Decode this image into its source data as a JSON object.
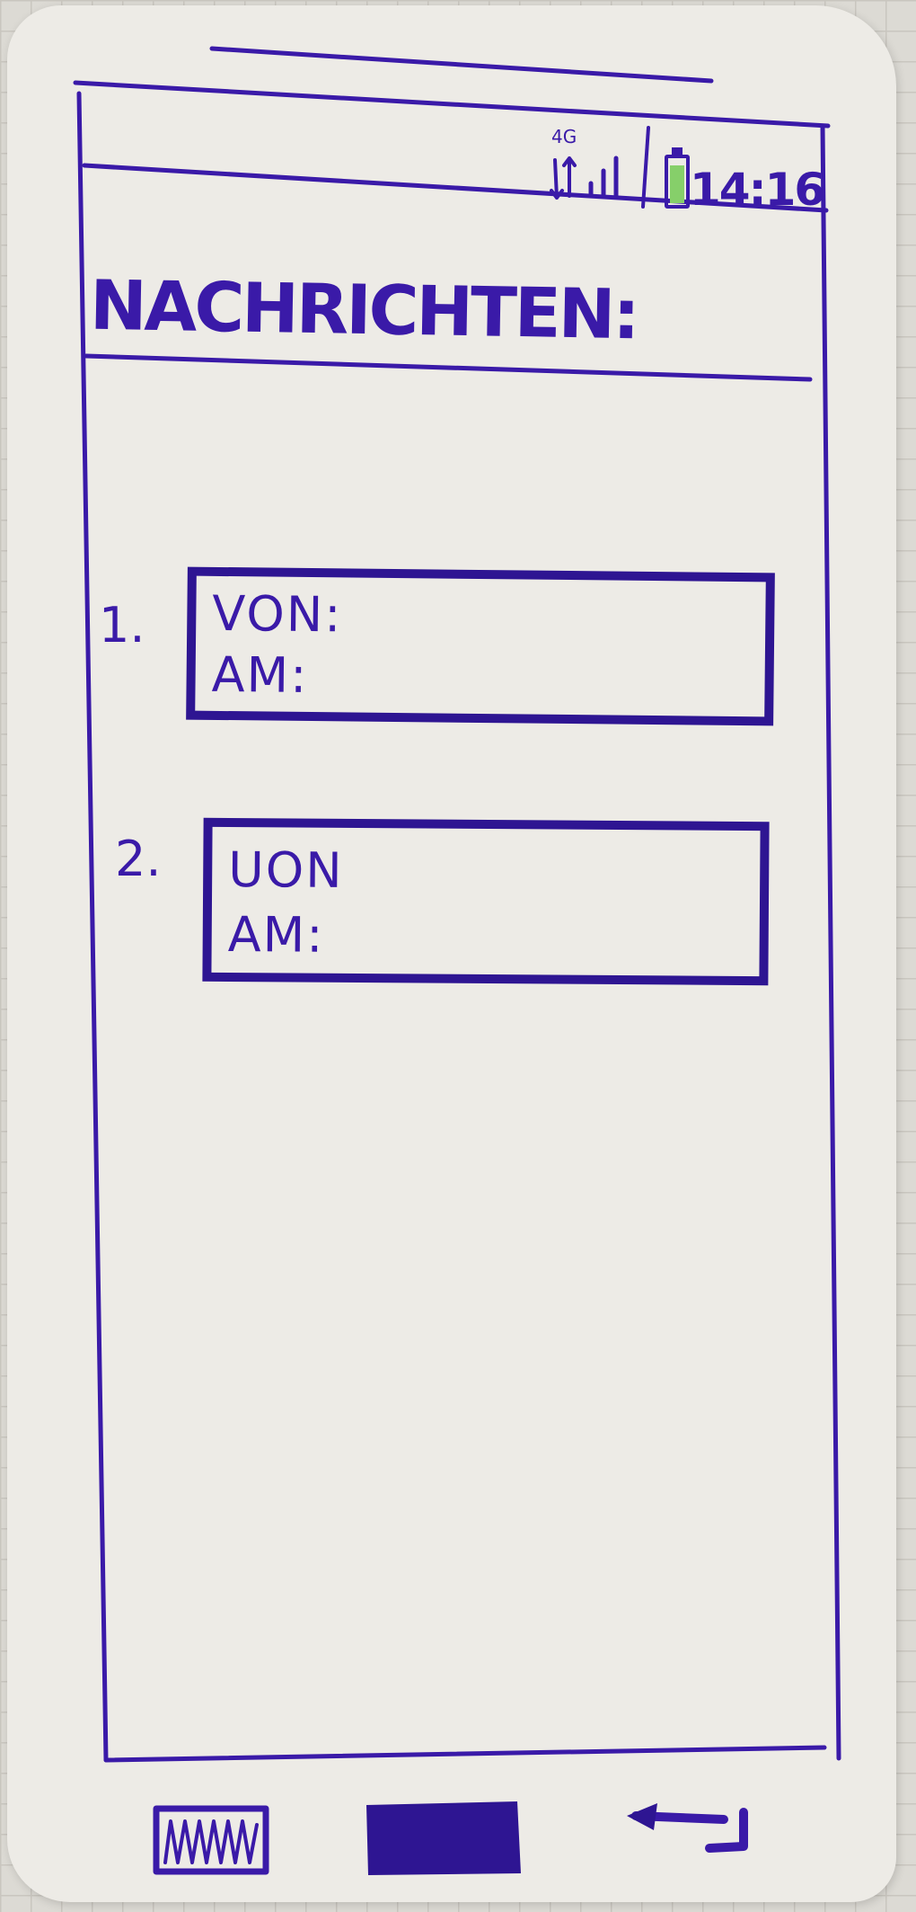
{
  "status_bar": {
    "network": "4G",
    "time": "14:16"
  },
  "page": {
    "title": "NACHRICHTEN:"
  },
  "messages": [
    {
      "number": "1.",
      "from_label": "VON:",
      "date_label": "AM:"
    },
    {
      "number": "2.",
      "from_label": "UON",
      "date_label": "AM:"
    }
  ],
  "colors": {
    "ink": "#3a1aa8",
    "battery": "#86cf6a",
    "paper": "#edebe6"
  },
  "nav": {
    "left_icon": "recent-apps-icon",
    "center_icon": "home-icon",
    "right_icon": "back-icon"
  }
}
